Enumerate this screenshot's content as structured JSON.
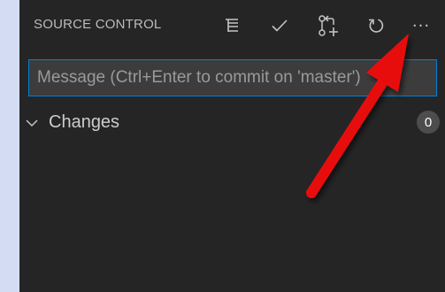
{
  "panel": {
    "title": "SOURCE CONTROL",
    "actions": [
      {
        "name": "view-as-tree-icon"
      },
      {
        "name": "commit-check-icon"
      },
      {
        "name": "pull-request-icon"
      },
      {
        "name": "refresh-icon"
      },
      {
        "name": "more-actions-icon",
        "glyph": "···"
      }
    ]
  },
  "commit": {
    "placeholder": "Message (Ctrl+Enter to commit on 'master')"
  },
  "changes": {
    "label": "Changes",
    "count": "0"
  },
  "colors": {
    "panel_bg": "#252526",
    "input_border": "#007fd4",
    "annotation_arrow": "#e81010"
  }
}
